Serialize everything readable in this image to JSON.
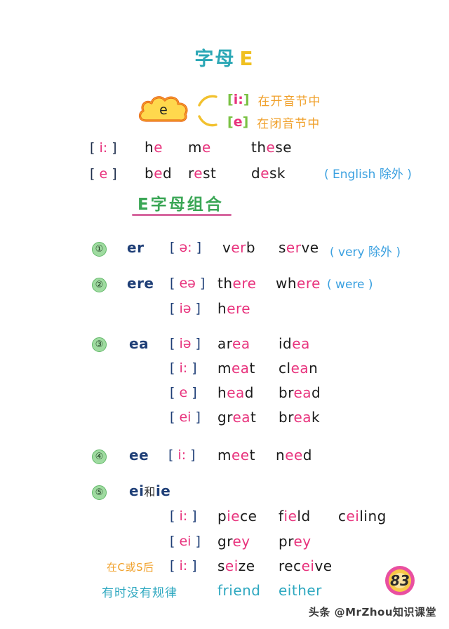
{
  "title": {
    "cn": "字母",
    "en": "E"
  },
  "cloud": {
    "letter": "e",
    "rows": [
      {
        "bracket_open": "[",
        "symbol": "i:",
        "bracket_close": "]",
        "note": "在开音节中"
      },
      {
        "bracket_open": "[",
        "symbol": "e",
        "bracket_close": "]",
        "note": "在闭音节中"
      }
    ]
  },
  "top_examples": [
    {
      "phonetic": "[ i: ]",
      "words": [
        {
          "pre": "h",
          "hl": "e",
          "post": ""
        },
        {
          "pre": "m",
          "hl": "e",
          "post": ""
        },
        {
          "pre": "th",
          "hl": "e",
          "post": "se"
        }
      ],
      "note": ""
    },
    {
      "phonetic": "[ e ]",
      "words": [
        {
          "pre": "b",
          "hl": "e",
          "post": "d"
        },
        {
          "pre": "r",
          "hl": "e",
          "post": "st"
        },
        {
          "pre": "d",
          "hl": "e",
          "post": "sk"
        }
      ],
      "note": "( English 除外 )"
    }
  ],
  "section": {
    "header": "E字母组合"
  },
  "groups": [
    {
      "number": "①",
      "combo": "er",
      "lines": [
        {
          "phonetic": "[ ə: ]",
          "words": [
            {
              "pre": "v",
              "hl": "er",
              "post": "b"
            },
            {
              "pre": "s",
              "hl": "er",
              "post": "ve"
            }
          ],
          "note": "( very 除外 )"
        }
      ]
    },
    {
      "number": "②",
      "combo": "ere",
      "lines": [
        {
          "phonetic": "[ eə ]",
          "words": [
            {
              "pre": "th",
              "hl": "ere",
              "post": ""
            },
            {
              "pre": "wh",
              "hl": "ere",
              "post": ""
            }
          ],
          "note": "( were )"
        },
        {
          "phonetic": "[ iə ]",
          "words": [
            {
              "pre": "h",
              "hl": "ere",
              "post": ""
            }
          ],
          "note": ""
        }
      ]
    },
    {
      "number": "③",
      "combo": "ea",
      "lines": [
        {
          "phonetic": "[ iə ]",
          "words": [
            {
              "pre": "ar",
              "hl": "ea",
              "post": ""
            },
            {
              "pre": "id",
              "hl": "ea",
              "post": ""
            }
          ],
          "note": ""
        },
        {
          "phonetic": "[ i: ]",
          "words": [
            {
              "pre": "m",
              "hl": "ea",
              "post": "t"
            },
            {
              "pre": "cl",
              "hl": "ea",
              "post": "n"
            }
          ],
          "note": ""
        },
        {
          "phonetic": "[ e ]",
          "words": [
            {
              "pre": "h",
              "hl": "ea",
              "post": "d"
            },
            {
              "pre": "br",
              "hl": "ea",
              "post": "d"
            }
          ],
          "note": ""
        },
        {
          "phonetic": "[ ei ]",
          "words": [
            {
              "pre": "gr",
              "hl": "ea",
              "post": "t"
            },
            {
              "pre": "br",
              "hl": "ea",
              "post": "k"
            }
          ],
          "note": ""
        }
      ]
    },
    {
      "number": "④",
      "combo": "ee",
      "lines": [
        {
          "phonetic": "[ i: ]",
          "words": [
            {
              "pre": "m",
              "hl": "ee",
              "post": "t"
            },
            {
              "pre": "n",
              "hl": "ee",
              "post": "d"
            }
          ],
          "note": ""
        }
      ]
    },
    {
      "number": "⑤",
      "combo": "ei",
      "combo_cn": "和",
      "combo2": "ie",
      "lines": [
        {
          "phonetic": "[ i: ]",
          "words": [
            {
              "pre": "p",
              "hl": "ie",
              "post": "ce"
            },
            {
              "pre": "f",
              "hl": "ie",
              "post": "ld"
            },
            {
              "pre": "c",
              "hl": "ei",
              "post": "ling"
            }
          ],
          "note": ""
        },
        {
          "phonetic": "[ ei ]",
          "words": [
            {
              "pre": "gr",
              "hl": "ey",
              "post": ""
            },
            {
              "pre": "pr",
              "hl": "ey",
              "post": ""
            }
          ],
          "note": ""
        },
        {
          "tag": "在C或S后",
          "phonetic": "[ i: ]",
          "words": [
            {
              "pre": "s",
              "hl": "ei",
              "post": "ze"
            },
            {
              "pre": "rec",
              "hl": "ei",
              "post": "ve"
            }
          ],
          "note": ""
        },
        {
          "tag_cyan": "有时没有规律",
          "phonetic": "",
          "words_cyan": [
            "friend",
            "either"
          ],
          "note": ""
        }
      ]
    }
  ],
  "page_number": "83",
  "watermark": "头条 @MrZhou知识课堂",
  "colors": {
    "title_cn": "#2aa7b5",
    "title_en": "#f0c020",
    "green": "#3aa655",
    "pink": "#e8337d",
    "navy": "#1f3f77",
    "orange": "#f0a02a",
    "cyan": "#2ea8c0",
    "blue_note": "#3aa0e0",
    "underline": "#d6679f"
  }
}
